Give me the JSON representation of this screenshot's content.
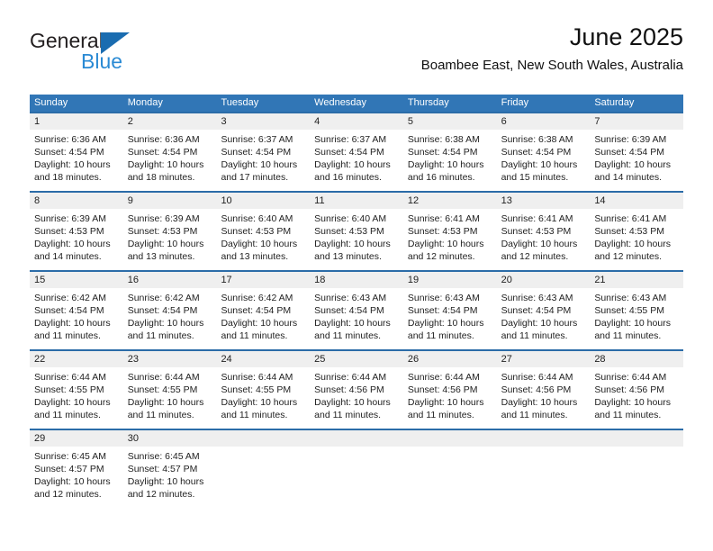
{
  "brand": {
    "line1": "General",
    "line2": "Blue",
    "mark": "triangle-logo"
  },
  "header": {
    "title": "June 2025",
    "subtitle": "Boambee East, New South Wales, Australia"
  },
  "colors": {
    "header_blue": "#3176b6",
    "week_divider_blue": "#2b6ca8",
    "daynum_band": "#efefef",
    "brand_blue": "#2a8ad4",
    "brand_mark_blue": "#1a6cb0"
  },
  "weekdays": [
    "Sunday",
    "Monday",
    "Tuesday",
    "Wednesday",
    "Thursday",
    "Friday",
    "Saturday"
  ],
  "weeks": [
    [
      {
        "day": "1",
        "sunrise": "Sunrise: 6:36 AM",
        "sunset": "Sunset: 4:54 PM",
        "daylight": "Daylight: 10 hours and 18 minutes."
      },
      {
        "day": "2",
        "sunrise": "Sunrise: 6:36 AM",
        "sunset": "Sunset: 4:54 PM",
        "daylight": "Daylight: 10 hours and 18 minutes."
      },
      {
        "day": "3",
        "sunrise": "Sunrise: 6:37 AM",
        "sunset": "Sunset: 4:54 PM",
        "daylight": "Daylight: 10 hours and 17 minutes."
      },
      {
        "day": "4",
        "sunrise": "Sunrise: 6:37 AM",
        "sunset": "Sunset: 4:54 PM",
        "daylight": "Daylight: 10 hours and 16 minutes."
      },
      {
        "day": "5",
        "sunrise": "Sunrise: 6:38 AM",
        "sunset": "Sunset: 4:54 PM",
        "daylight": "Daylight: 10 hours and 16 minutes."
      },
      {
        "day": "6",
        "sunrise": "Sunrise: 6:38 AM",
        "sunset": "Sunset: 4:54 PM",
        "daylight": "Daylight: 10 hours and 15 minutes."
      },
      {
        "day": "7",
        "sunrise": "Sunrise: 6:39 AM",
        "sunset": "Sunset: 4:54 PM",
        "daylight": "Daylight: 10 hours and 14 minutes."
      }
    ],
    [
      {
        "day": "8",
        "sunrise": "Sunrise: 6:39 AM",
        "sunset": "Sunset: 4:53 PM",
        "daylight": "Daylight: 10 hours and 14 minutes."
      },
      {
        "day": "9",
        "sunrise": "Sunrise: 6:39 AM",
        "sunset": "Sunset: 4:53 PM",
        "daylight": "Daylight: 10 hours and 13 minutes."
      },
      {
        "day": "10",
        "sunrise": "Sunrise: 6:40 AM",
        "sunset": "Sunset: 4:53 PM",
        "daylight": "Daylight: 10 hours and 13 minutes."
      },
      {
        "day": "11",
        "sunrise": "Sunrise: 6:40 AM",
        "sunset": "Sunset: 4:53 PM",
        "daylight": "Daylight: 10 hours and 13 minutes."
      },
      {
        "day": "12",
        "sunrise": "Sunrise: 6:41 AM",
        "sunset": "Sunset: 4:53 PM",
        "daylight": "Daylight: 10 hours and 12 minutes."
      },
      {
        "day": "13",
        "sunrise": "Sunrise: 6:41 AM",
        "sunset": "Sunset: 4:53 PM",
        "daylight": "Daylight: 10 hours and 12 minutes."
      },
      {
        "day": "14",
        "sunrise": "Sunrise: 6:41 AM",
        "sunset": "Sunset: 4:53 PM",
        "daylight": "Daylight: 10 hours and 12 minutes."
      }
    ],
    [
      {
        "day": "15",
        "sunrise": "Sunrise: 6:42 AM",
        "sunset": "Sunset: 4:54 PM",
        "daylight": "Daylight: 10 hours and 11 minutes."
      },
      {
        "day": "16",
        "sunrise": "Sunrise: 6:42 AM",
        "sunset": "Sunset: 4:54 PM",
        "daylight": "Daylight: 10 hours and 11 minutes."
      },
      {
        "day": "17",
        "sunrise": "Sunrise: 6:42 AM",
        "sunset": "Sunset: 4:54 PM",
        "daylight": "Daylight: 10 hours and 11 minutes."
      },
      {
        "day": "18",
        "sunrise": "Sunrise: 6:43 AM",
        "sunset": "Sunset: 4:54 PM",
        "daylight": "Daylight: 10 hours and 11 minutes."
      },
      {
        "day": "19",
        "sunrise": "Sunrise: 6:43 AM",
        "sunset": "Sunset: 4:54 PM",
        "daylight": "Daylight: 10 hours and 11 minutes."
      },
      {
        "day": "20",
        "sunrise": "Sunrise: 6:43 AM",
        "sunset": "Sunset: 4:54 PM",
        "daylight": "Daylight: 10 hours and 11 minutes."
      },
      {
        "day": "21",
        "sunrise": "Sunrise: 6:43 AM",
        "sunset": "Sunset: 4:55 PM",
        "daylight": "Daylight: 10 hours and 11 minutes."
      }
    ],
    [
      {
        "day": "22",
        "sunrise": "Sunrise: 6:44 AM",
        "sunset": "Sunset: 4:55 PM",
        "daylight": "Daylight: 10 hours and 11 minutes."
      },
      {
        "day": "23",
        "sunrise": "Sunrise: 6:44 AM",
        "sunset": "Sunset: 4:55 PM",
        "daylight": "Daylight: 10 hours and 11 minutes."
      },
      {
        "day": "24",
        "sunrise": "Sunrise: 6:44 AM",
        "sunset": "Sunset: 4:55 PM",
        "daylight": "Daylight: 10 hours and 11 minutes."
      },
      {
        "day": "25",
        "sunrise": "Sunrise: 6:44 AM",
        "sunset": "Sunset: 4:56 PM",
        "daylight": "Daylight: 10 hours and 11 minutes."
      },
      {
        "day": "26",
        "sunrise": "Sunrise: 6:44 AM",
        "sunset": "Sunset: 4:56 PM",
        "daylight": "Daylight: 10 hours and 11 minutes."
      },
      {
        "day": "27",
        "sunrise": "Sunrise: 6:44 AM",
        "sunset": "Sunset: 4:56 PM",
        "daylight": "Daylight: 10 hours and 11 minutes."
      },
      {
        "day": "28",
        "sunrise": "Sunrise: 6:44 AM",
        "sunset": "Sunset: 4:56 PM",
        "daylight": "Daylight: 10 hours and 11 minutes."
      }
    ],
    [
      {
        "day": "29",
        "sunrise": "Sunrise: 6:45 AM",
        "sunset": "Sunset: 4:57 PM",
        "daylight": "Daylight: 10 hours and 12 minutes."
      },
      {
        "day": "30",
        "sunrise": "Sunrise: 6:45 AM",
        "sunset": "Sunset: 4:57 PM",
        "daylight": "Daylight: 10 hours and 12 minutes."
      },
      {
        "day": "",
        "sunrise": "",
        "sunset": "",
        "daylight": ""
      },
      {
        "day": "",
        "sunrise": "",
        "sunset": "",
        "daylight": ""
      },
      {
        "day": "",
        "sunrise": "",
        "sunset": "",
        "daylight": ""
      },
      {
        "day": "",
        "sunrise": "",
        "sunset": "",
        "daylight": ""
      },
      {
        "day": "",
        "sunrise": "",
        "sunset": "",
        "daylight": ""
      }
    ]
  ]
}
